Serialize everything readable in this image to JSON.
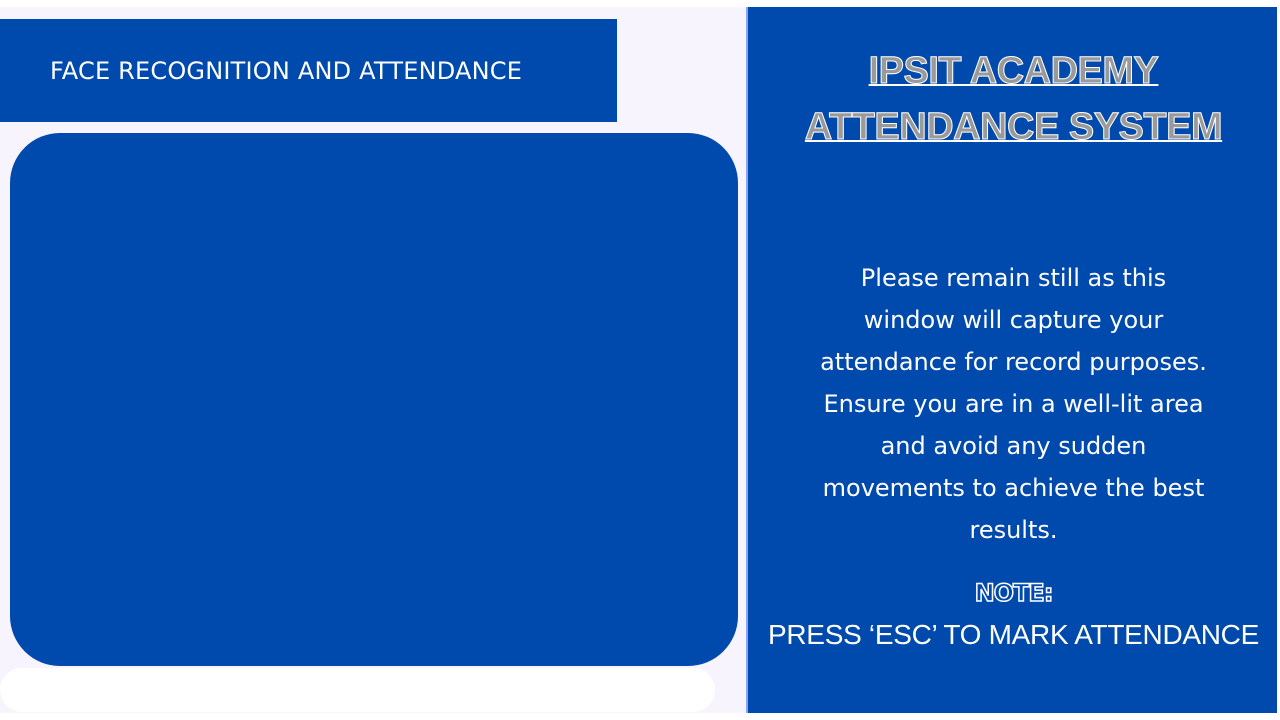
{
  "header": {
    "title": "FACE RECOGNITION AND ATTENDANCE"
  },
  "sidebar": {
    "title_lines": [
      "IPSIT ACADEMY",
      "ATTENDANCE SYSTEM"
    ],
    "instructions_lines": [
      "Please remain still as this",
      "window will capture your",
      "attendance for record purposes.",
      "Ensure you are in a well-lit area",
      "and avoid any sudden",
      "movements to achieve the best",
      "results."
    ],
    "note_label": "NOTE:",
    "note_text": "PRESS ‘ESC’ TO MARK ATTENDANCE"
  },
  "colors": {
    "brand_blue": "#004aad",
    "background": "#f8f4fd",
    "text": "#ffffff",
    "title_fill": "#9a9a9a"
  }
}
